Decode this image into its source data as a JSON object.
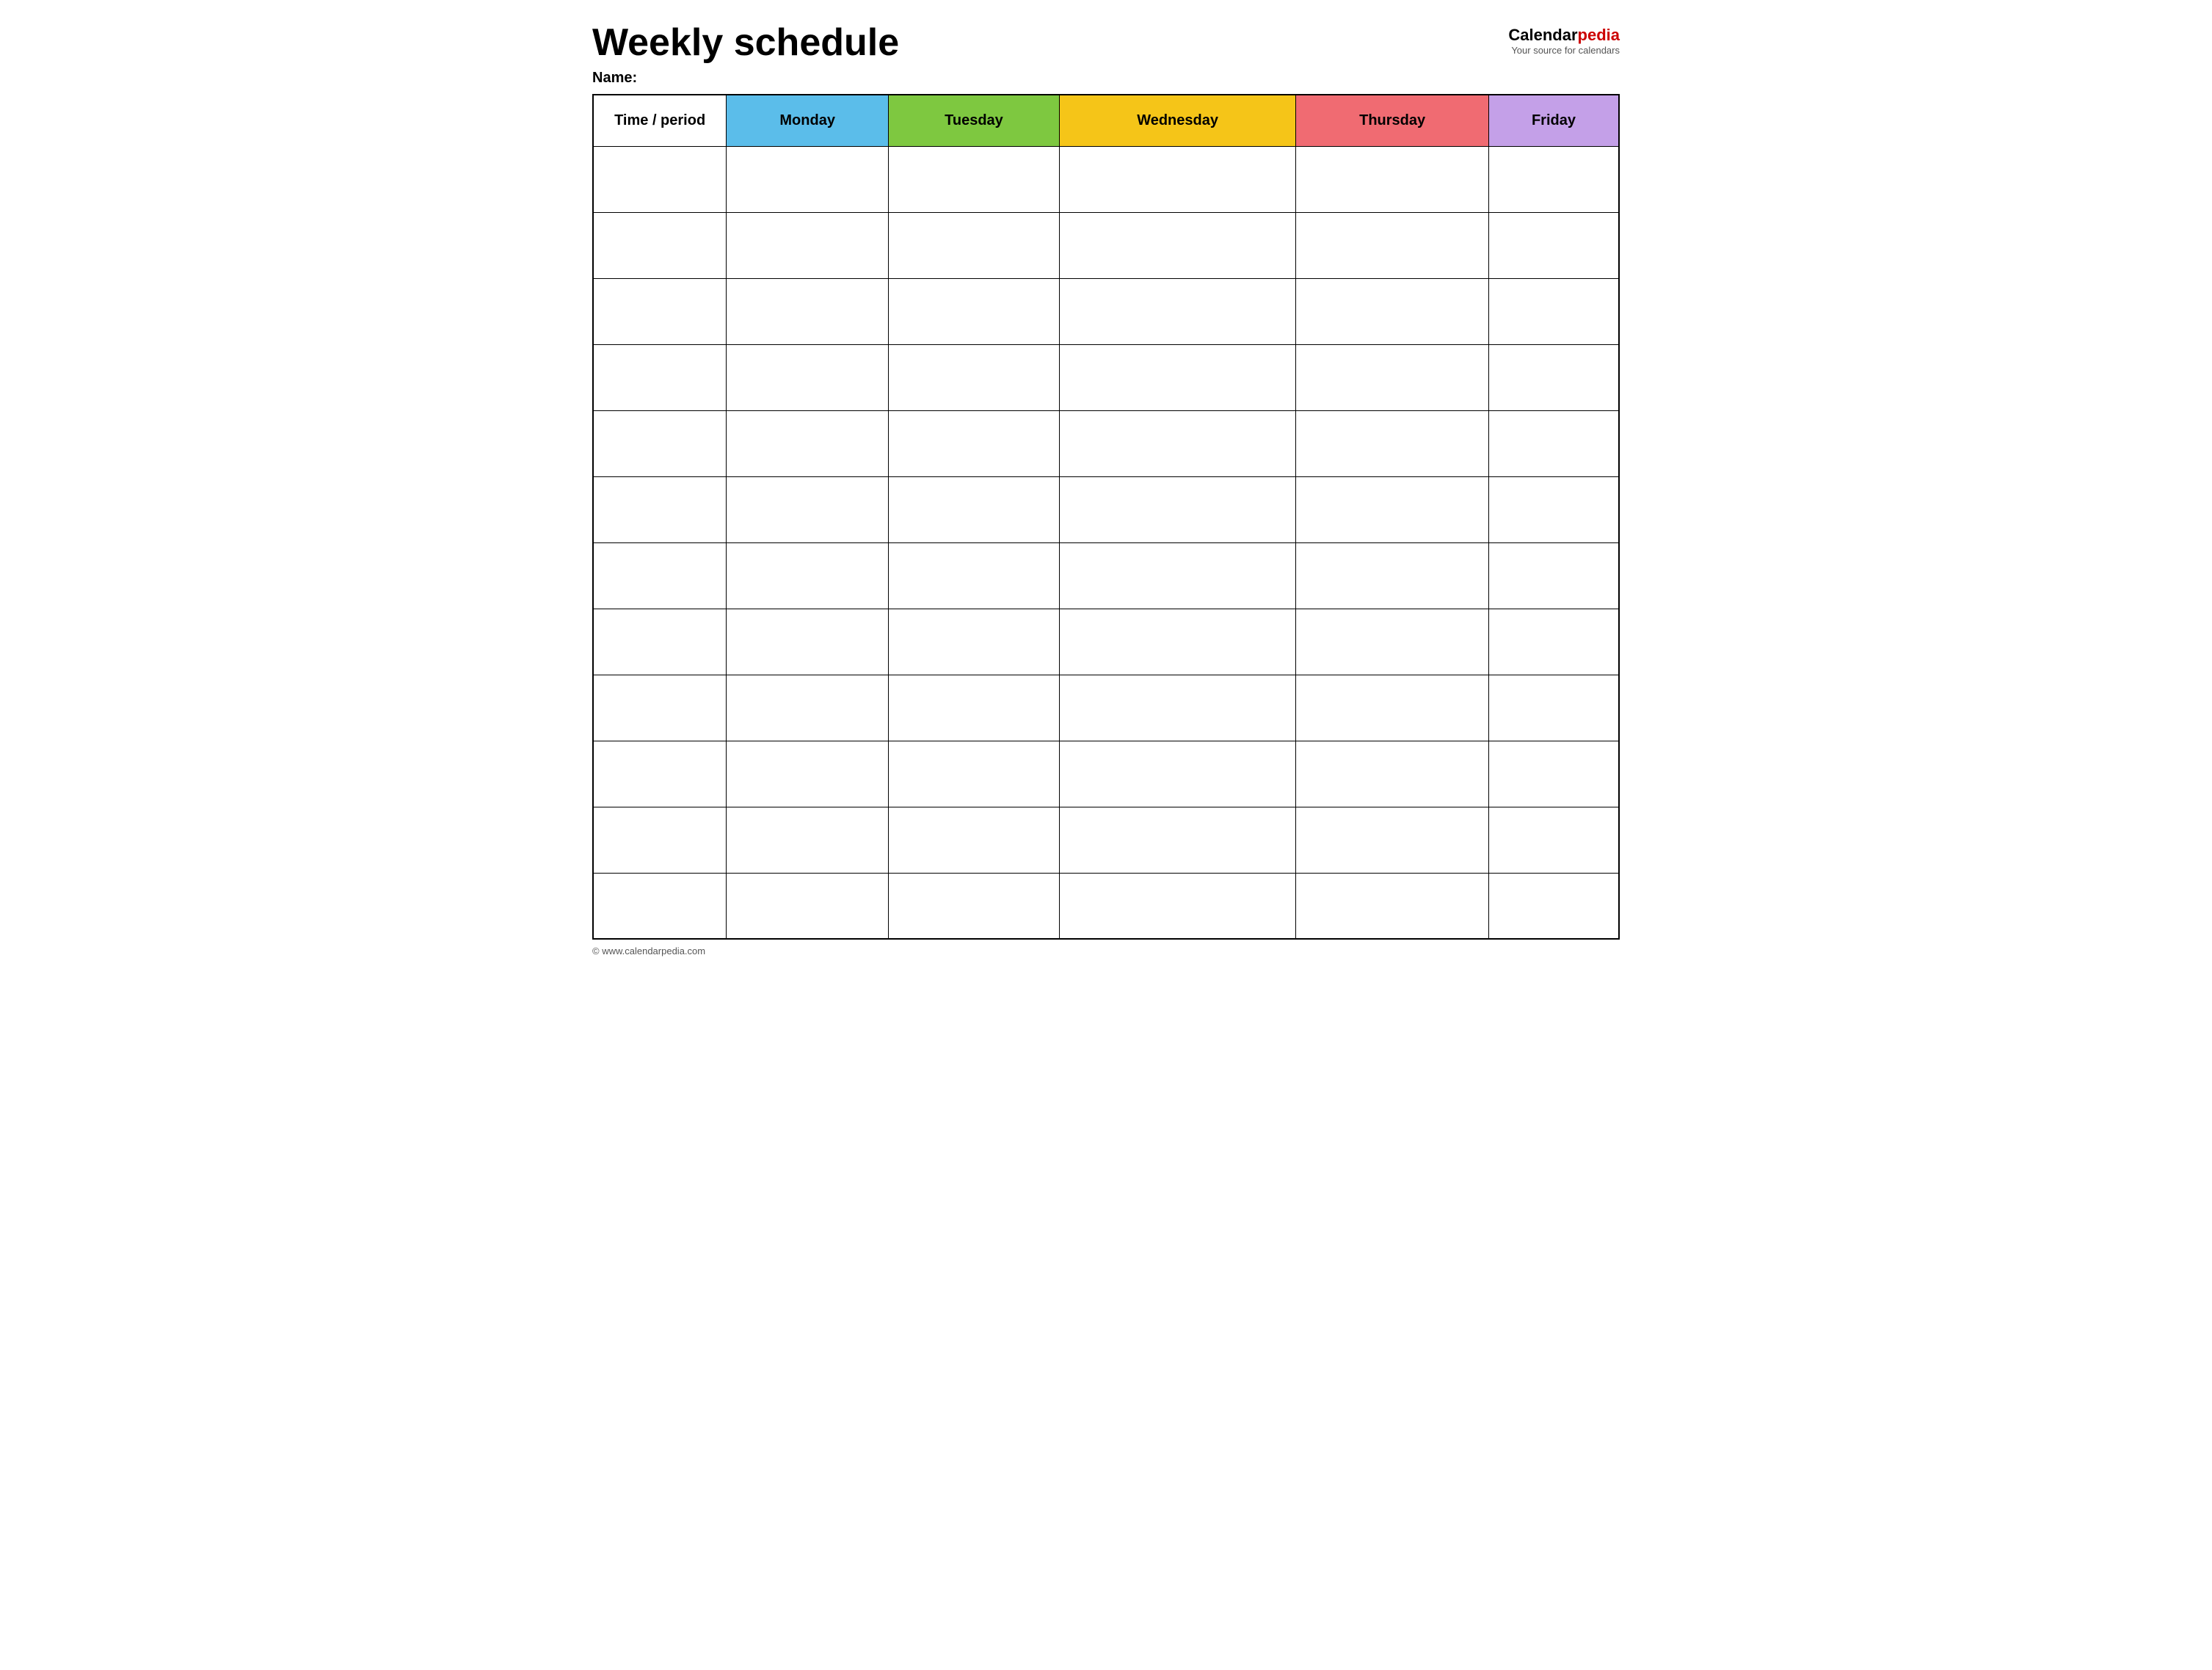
{
  "header": {
    "title": "Weekly schedule",
    "name_label": "Name:",
    "logo_calendar": "Calendar",
    "logo_pedia": "pedia",
    "logo_tagline": "Your source for calendars"
  },
  "table": {
    "columns": [
      {
        "id": "time",
        "label": "Time / period",
        "color": "#ffffff"
      },
      {
        "id": "monday",
        "label": "Monday",
        "color": "#5bbdea"
      },
      {
        "id": "tuesday",
        "label": "Tuesday",
        "color": "#7ec840"
      },
      {
        "id": "wednesday",
        "label": "Wednesday",
        "color": "#f5c518"
      },
      {
        "id": "thursday",
        "label": "Thursday",
        "color": "#f06b72"
      },
      {
        "id": "friday",
        "label": "Friday",
        "color": "#c4a0e8"
      }
    ],
    "rows": 12
  },
  "footer": {
    "copyright": "© www.calendarpedia.com"
  }
}
